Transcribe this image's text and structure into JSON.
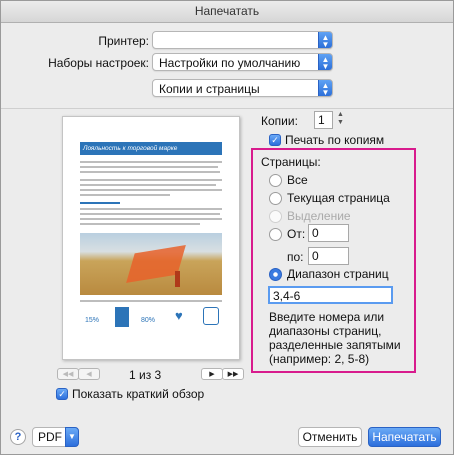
{
  "window": {
    "title": "Напечатать"
  },
  "printer": {
    "label": "Принтер:",
    "value": ""
  },
  "presets": {
    "label": "Наборы настроек:",
    "value": "Настройки по умолчанию"
  },
  "section": {
    "value": "Копии и страницы"
  },
  "preview": {
    "doc_title": "Лояльность к торговой марке",
    "page_indicator": "1 из 3",
    "stat1": "15%",
    "stat2": "80%",
    "first_label": "◀◀",
    "prev_label": "◀",
    "next_label": "▶",
    "last_label": "▶▶"
  },
  "copies": {
    "label": "Копии:",
    "value": "1",
    "collate_label": "Печать по копиям",
    "collate_checked": true
  },
  "pages": {
    "label": "Страницы:",
    "all_label": "Все",
    "current_label": "Текущая страница",
    "selection_label": "Выделение",
    "from_label": "От:",
    "from_value": "0",
    "to_label": "по:",
    "to_value": "0",
    "range_label": "Диапазон страниц",
    "range_value": "3,4-6",
    "hint": "Введите номера или диапазоны страниц, разделенные запятыми (например: 2, 5-8)",
    "selected": "range"
  },
  "show_preview": {
    "label": "Показать краткий обзор",
    "checked": true
  },
  "footer": {
    "help": "?",
    "pdf_label": "PDF",
    "cancel_label": "Отменить",
    "print_label": "Напечатать"
  },
  "colors": {
    "accent": "#2d6fdc",
    "highlight": "#d81b8d",
    "banner": "#2c74b8"
  }
}
